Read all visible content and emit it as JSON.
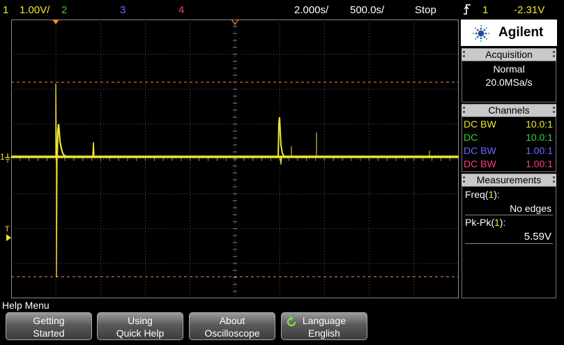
{
  "topbar": {
    "ch1_num": "1",
    "ch1_scale": "1.00V/",
    "ch2_num": "2",
    "ch3_num": "3",
    "ch4_num": "4",
    "time_scale": "2.000s/",
    "delay": "500.0s/",
    "run_state": "Stop",
    "trigger_channel": "1",
    "trigger_level": "-2.31V",
    "colors": {
      "ch1": "#f0e631",
      "ch2": "#38d038",
      "ch3": "#6a6aff",
      "ch4": "#ff3a8a"
    }
  },
  "panel": {
    "brand": "Agilent",
    "acquisition": {
      "header": "Acquisition",
      "mode": "Normal",
      "rate": "20.0MSa/s"
    },
    "channels": {
      "header": "Channels",
      "rows": [
        {
          "coupling": "DC",
          "bw": "BW",
          "probe": "10.0:1",
          "color": "#f0e631"
        },
        {
          "coupling": "DC",
          "bw": "",
          "probe": "10.0:1",
          "color": "#38d038"
        },
        {
          "coupling": "DC",
          "bw": "BW",
          "probe": "1.00:1",
          "color": "#6a6aff"
        },
        {
          "coupling": "DC",
          "bw": "BW",
          "probe": "1.00:1",
          "color": "#ff3a8a"
        }
      ]
    },
    "measurements": {
      "header": "Measurements",
      "freq_label": "Freq(1):",
      "freq_value": "No edges",
      "pkpk_label": "Pk-Pk(1):",
      "pkpk_value": "5.59V"
    }
  },
  "screen": {
    "ch1_marker": "1",
    "trigger_marker": "T"
  },
  "help_menu": {
    "title": "Help Menu",
    "keys": [
      {
        "line1": "Getting",
        "line2": "Started"
      },
      {
        "line1": "Using",
        "line2": "Quick Help"
      },
      {
        "line1": "About",
        "line2": "Oscilloscope"
      },
      {
        "line1": "Language",
        "line2": "English"
      }
    ]
  }
}
